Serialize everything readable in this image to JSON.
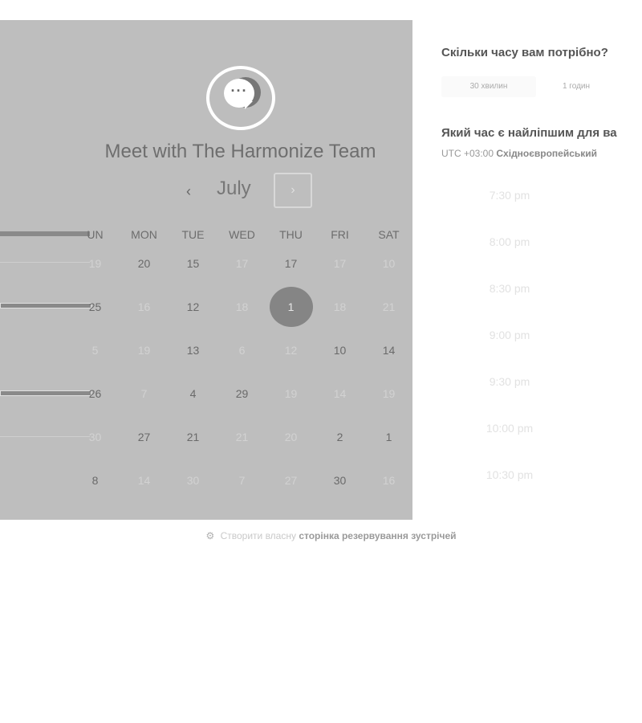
{
  "calendar": {
    "title": "Meet with The Harmonize Team",
    "month": "July",
    "prev_glyph": "‹",
    "next_glyph": "›",
    "weekdays": [
      "UN",
      "MON",
      "TUE",
      "WED",
      "THU",
      "FRI",
      "SAT"
    ],
    "weeks": [
      [
        {
          "d": "19",
          "m": true
        },
        {
          "d": "20"
        },
        {
          "d": "15"
        },
        {
          "d": "17",
          "m": true
        },
        {
          "d": "17"
        },
        {
          "d": "17",
          "m": true
        },
        {
          "d": "10",
          "m": true
        }
      ],
      [
        {
          "d": "25"
        },
        {
          "d": "16",
          "m": true
        },
        {
          "d": "12"
        },
        {
          "d": "18",
          "m": true
        },
        {
          "d": "1",
          "s": true
        },
        {
          "d": "18",
          "m": true
        },
        {
          "d": "21",
          "m": true
        }
      ],
      [
        {
          "d": "5",
          "m": true
        },
        {
          "d": "19",
          "m": true
        },
        {
          "d": "13"
        },
        {
          "d": "6",
          "m": true
        },
        {
          "d": "12",
          "m": true
        },
        {
          "d": "10"
        },
        {
          "d": "14"
        }
      ],
      [
        {
          "d": "26"
        },
        {
          "d": "7",
          "m": true
        },
        {
          "d": "4"
        },
        {
          "d": "29"
        },
        {
          "d": "19",
          "m": true
        },
        {
          "d": "14",
          "m": true
        },
        {
          "d": "19",
          "m": true
        }
      ],
      [
        {
          "d": "30",
          "m": true
        },
        {
          "d": "27"
        },
        {
          "d": "21"
        },
        {
          "d": "21",
          "m": true
        },
        {
          "d": "20",
          "m": true
        },
        {
          "d": "2"
        },
        {
          "d": "1"
        }
      ],
      [
        {
          "d": "8"
        },
        {
          "d": "14",
          "m": true
        },
        {
          "d": "30",
          "m": true
        },
        {
          "d": "7",
          "m": true
        },
        {
          "d": "27",
          "m": true
        },
        {
          "d": "30"
        },
        {
          "d": "16",
          "m": true
        }
      ]
    ]
  },
  "duration": {
    "question": "Скільки часу вам потрібно?",
    "options": [
      "30 хвилин",
      "1 годин"
    ]
  },
  "time": {
    "question": "Який час є найліпшим для ва",
    "tz_prefix": "UTC +03:00",
    "tz_name": "Східноєвропейський",
    "slots": [
      "7:30 pm",
      "8:00 pm",
      "8:30 pm",
      "9:00 pm",
      "9:30 pm",
      "10:00 pm",
      "10:30 pm"
    ]
  },
  "footer": {
    "prefix": "Створити власну",
    "link": "сторінка резервування зустрічей"
  },
  "colors": {
    "panel_bg": "#bebebe",
    "selected_day": "#858585"
  }
}
